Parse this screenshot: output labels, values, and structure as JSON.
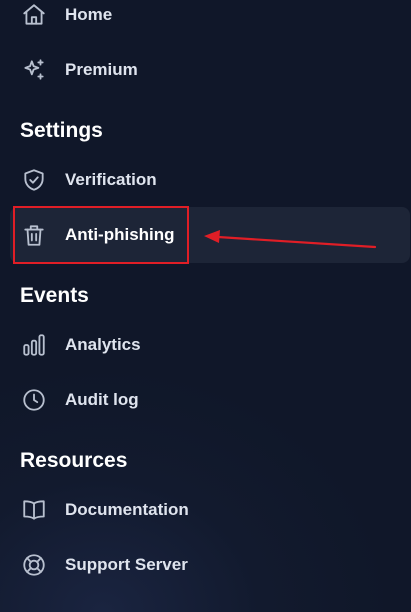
{
  "nav": {
    "home": {
      "label": "Home",
      "icon": "home-icon"
    },
    "premium": {
      "label": "Premium",
      "icon": "sparkles-icon"
    }
  },
  "sections": {
    "settings": {
      "heading": "Settings",
      "items": [
        {
          "label": "Verification",
          "icon": "shield-check-icon"
        },
        {
          "label": "Anti-phishing",
          "icon": "trash-icon",
          "active": true
        }
      ]
    },
    "events": {
      "heading": "Events",
      "items": [
        {
          "label": "Analytics",
          "icon": "bar-chart-icon"
        },
        {
          "label": "Audit log",
          "icon": "clock-icon"
        }
      ]
    },
    "resources": {
      "heading": "Resources",
      "items": [
        {
          "label": "Documentation",
          "icon": "book-open-icon"
        },
        {
          "label": "Support Server",
          "icon": "life-buoy-icon"
        }
      ]
    }
  },
  "colors": {
    "background": "#121a2e",
    "active_item_bg": "#1d2537",
    "icon_stroke": "#b8c0cf",
    "annotation_red": "#e01e26"
  }
}
